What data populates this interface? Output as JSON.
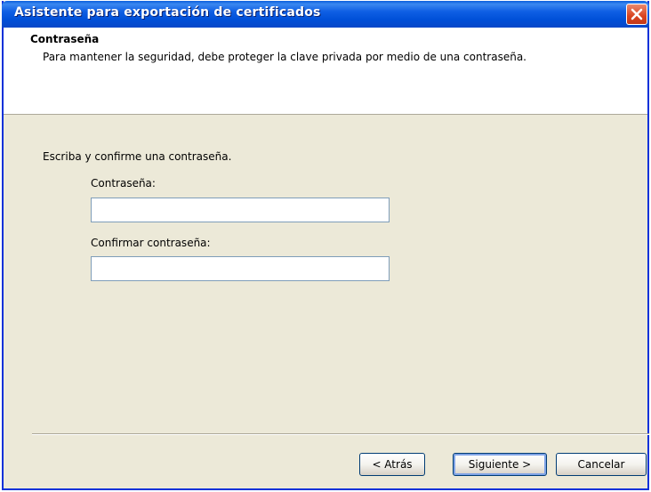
{
  "window": {
    "title": "Asistente para exportación de certificados",
    "close_icon": "close-icon"
  },
  "header": {
    "title": "Contraseña",
    "description": "Para mantener la seguridad, debe proteger la clave privada por medio de una contraseña."
  },
  "body": {
    "instructions": "Escriba y confirme una contraseña.",
    "password_label": "Contraseña:",
    "password_value": "",
    "confirm_label": "Confirmar contraseña:",
    "confirm_value": ""
  },
  "buttons": {
    "back": "< Atrás",
    "next": "Siguiente >",
    "cancel": "Cancelar"
  },
  "colors": {
    "titlebar": "#0050d8",
    "dialog_bg": "#ece9d8",
    "close_button": "#d9431f"
  }
}
